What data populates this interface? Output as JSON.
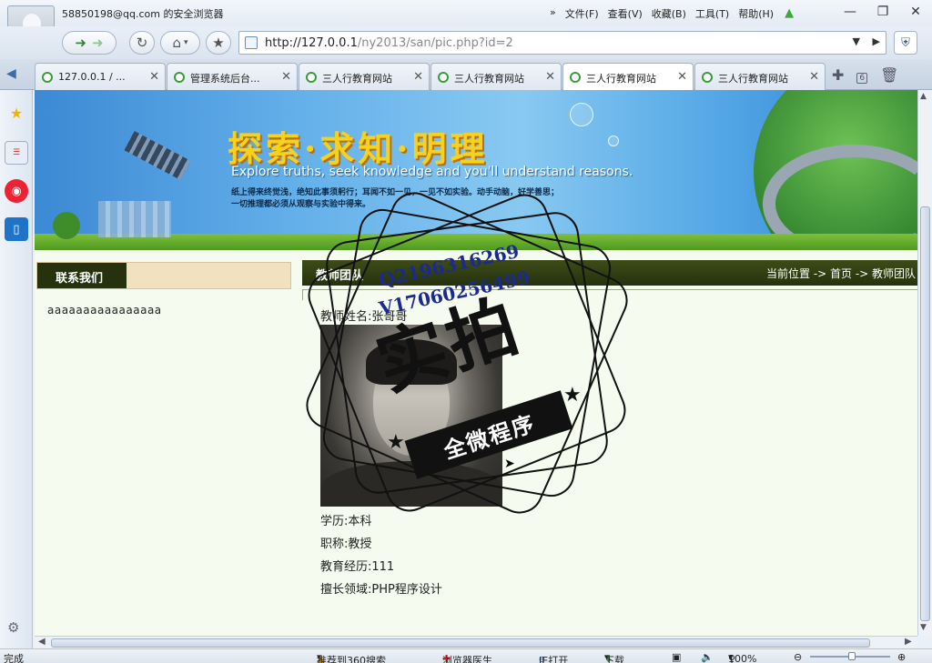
{
  "browser": {
    "account": "58850198@qq.com 的安全浏览器",
    "menu": [
      "文件(F)",
      "查看(V)",
      "收藏(B)",
      "工具(T)",
      "帮助(H)"
    ],
    "address": {
      "host": "http://127.0.0.1",
      "path": "/ny2013/san/pic.php?id=2"
    },
    "tabs": [
      {
        "label": "127.0.0.1 / ..."
      },
      {
        "label": "管理系统后台..."
      },
      {
        "label": "三人行教育网站"
      },
      {
        "label": "三人行教育网站"
      },
      {
        "label": "三人行教育网站"
      },
      {
        "label": "三人行教育网站"
      }
    ],
    "active_tab": 4,
    "tab_count": "6",
    "status": {
      "left": "完成",
      "recommend": "推荐到360搜索",
      "doctor": "浏览器医生",
      "ie": "IE打开",
      "download": "下载",
      "zoom": "100%"
    }
  },
  "page": {
    "banner": {
      "slogan": "探索·求知·明理",
      "slogan_en": "Explore truths, seek knowledge and you'll understand reasons.",
      "slogan_cn_1": "纸上得来终觉浅，绝知此事须躬行；耳闻不如一见，一见不如实验。动手动脑，好学善思；",
      "slogan_cn_2": "一切推理都必须从观察与实验中得来。"
    },
    "contact": {
      "title": "联系我们",
      "content": "aaaaaaaaaaaaaaaa"
    },
    "team": {
      "title": "教师团队",
      "breadcrumb": "当前位置 -> 首页 -> 教师团队",
      "teacher_name": "教师姓名:张哥哥",
      "education": "学历:本科",
      "title_rank": "职称:教授",
      "experience": "教育经历:111",
      "specialty": "擅长领域:PHP程序设计"
    },
    "watermark": {
      "big": "实拍",
      "small": "全微程序",
      "q": "Q2196316269",
      "v": "V17060256499"
    }
  }
}
